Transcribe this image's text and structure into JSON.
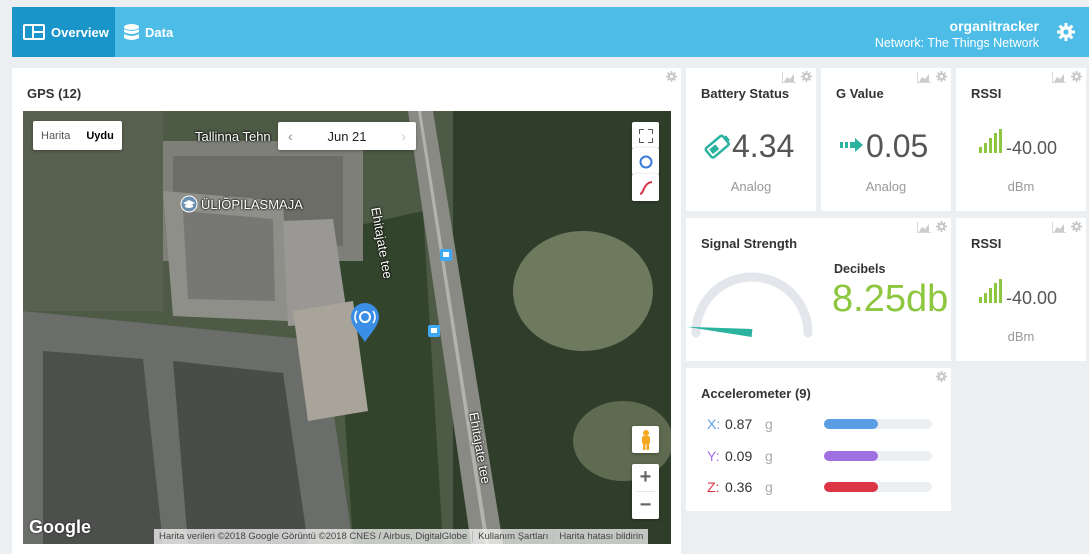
{
  "header": {
    "tabs": [
      {
        "label": "Overview",
        "icon": "dashboard-icon"
      },
      {
        "label": "Data",
        "icon": "database-icon"
      }
    ],
    "app_name": "organitracker",
    "network": "Network: The Things Network",
    "settings_icon": "gear-icon"
  },
  "gps": {
    "title": "GPS (12)",
    "map_type_options": [
      "Harita",
      "Uydu"
    ],
    "selected_map_type": "Uydu",
    "date": "Jun 21",
    "labels": {
      "place_top": "Tallinna Tehn",
      "place_building": "ÜLIÕPILASMAJA",
      "street_1": "Ehitajate tee",
      "street_2": "Ehitajate tee"
    },
    "logo": "Google",
    "attribution": [
      "Harita verileri ©2018 Google Görüntü ©2018 CNES / Airbus, DigitalGlobe",
      "Kullanım Şartları",
      "Harita hatası bildirin"
    ],
    "zoom_in": "+",
    "zoom_out": "−"
  },
  "battery": {
    "title": "Battery Status",
    "value": "4.34",
    "unit": "Analog",
    "icon": "battery-icon",
    "icon_color": "#2bb3a0"
  },
  "gvalue": {
    "title": "G Value",
    "value": "0.05",
    "unit": "Analog",
    "icon": "arrow-right-icon",
    "icon_color": "#2bb3a0"
  },
  "rssi1": {
    "title": "RSSI",
    "value": "-40.00",
    "unit": "dBm",
    "icon": "signal-bars-icon",
    "icon_color": "#8dc63f"
  },
  "signal": {
    "title": "Signal Strength",
    "label": "Decibels",
    "value": "8.25db",
    "gauge_level": 0.03,
    "value_color": "#8dc63f",
    "needle_color": "#2bb3a0"
  },
  "rssi2": {
    "title": "RSSI",
    "value": "-40.00",
    "unit": "dBm",
    "icon": "signal-bars-icon",
    "icon_color": "#8dc63f"
  },
  "accelerometer": {
    "title": "Accelerometer (9)",
    "rows": [
      {
        "axis": "X:",
        "value": "0.87",
        "unit": "g",
        "fill": 0.5,
        "color": "#5b9ee6"
      },
      {
        "axis": "Y:",
        "value": "0.09",
        "unit": "g",
        "fill": 0.5,
        "color": "#a070e0"
      },
      {
        "axis": "Z:",
        "value": "0.36",
        "unit": "g",
        "fill": 0.5,
        "color": "#dc3545"
      }
    ]
  }
}
